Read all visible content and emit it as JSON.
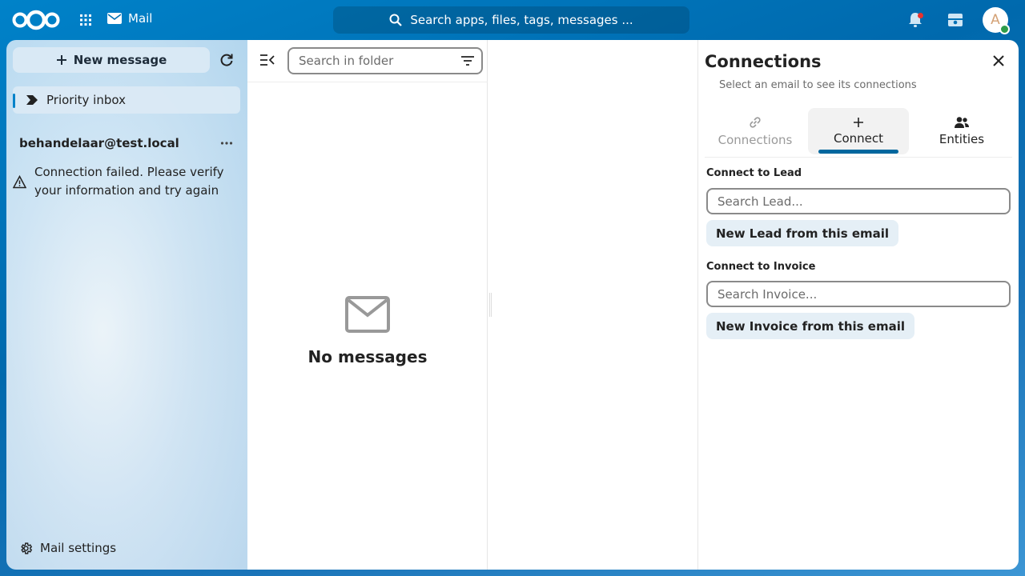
{
  "header": {
    "app_name": "Mail",
    "search_placeholder": "Search apps, files, tags, messages ...",
    "avatar_initial": "A"
  },
  "sidebar": {
    "new_message_label": "New message",
    "priority_inbox_label": "Priority inbox",
    "account_email": "behandelaar@test.local",
    "connection_error": "Connection failed. Please verify your information and try again",
    "settings_label": "Mail settings"
  },
  "message_list": {
    "search_placeholder": "Search in folder",
    "empty_title": "No messages"
  },
  "panel": {
    "title": "Connections",
    "subtitle": "Select an email to see its connections",
    "tabs": [
      {
        "label": "Connections",
        "icon": "link-icon"
      },
      {
        "label": "Connect",
        "icon": "plus-icon"
      },
      {
        "label": "Entities",
        "icon": "users-icon"
      }
    ],
    "active_tab": "Connect",
    "lead": {
      "label": "Connect to Lead",
      "placeholder": "Search Lead...",
      "button": "New Lead from this email"
    },
    "invoice": {
      "label": "Connect to Invoice",
      "placeholder": "Search Invoice...",
      "button": "New Invoice from this email"
    }
  },
  "colors": {
    "brand": "#0082c9",
    "active_tab_underline": "#00679e",
    "status_online": "#2d9c4a",
    "notification": "#e9322d"
  }
}
